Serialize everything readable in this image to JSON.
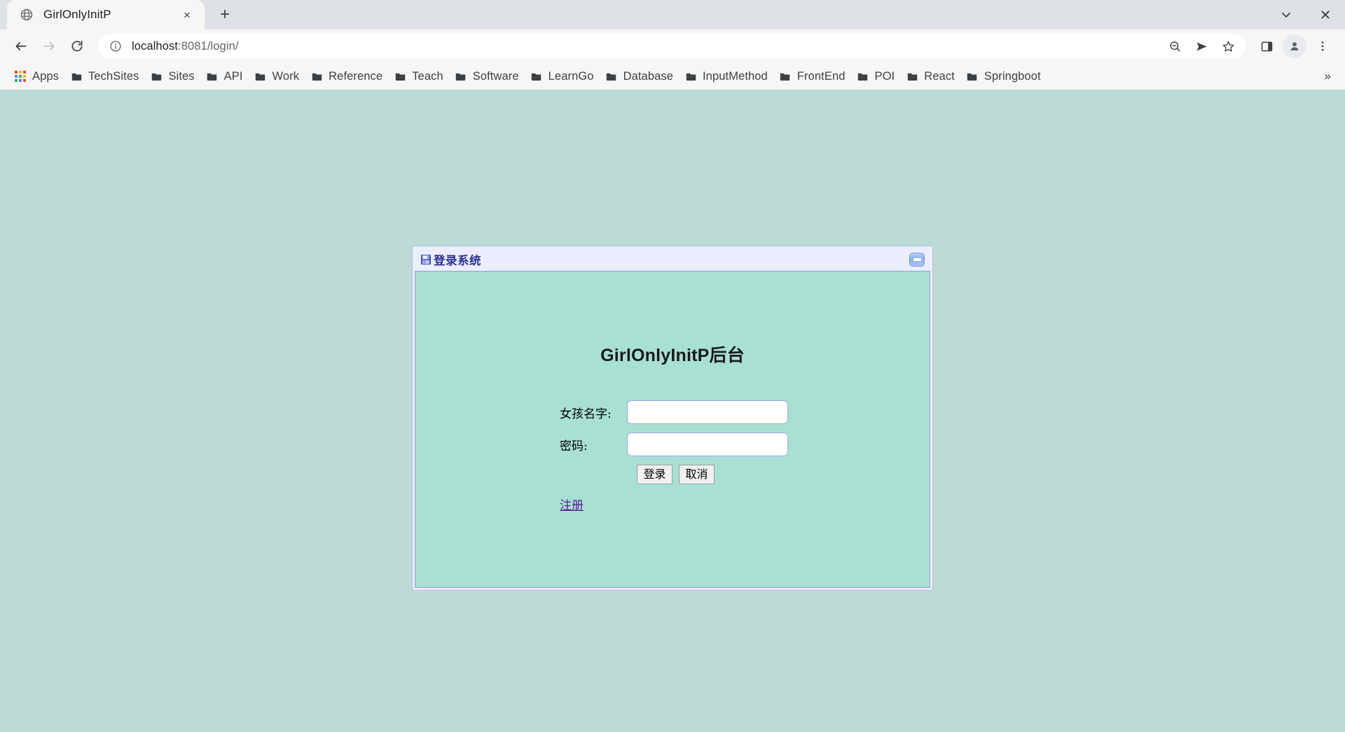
{
  "browser": {
    "tab": {
      "favicon": "globe-icon",
      "title": "GirlOnlyInitP",
      "close_label": "×",
      "newtab_label": "+"
    },
    "window_controls": [
      {
        "name": "minimize-window-button",
        "glyph": "⌄"
      },
      {
        "name": "close-window-button",
        "glyph": "✕"
      }
    ],
    "nav": {
      "back_label": "←",
      "forward_label": "→",
      "reload_label": "↻"
    },
    "omnibox": {
      "info_icon": "info-circle-icon",
      "url_host": "localhost",
      "url_rest": ":8081/login/",
      "full_url": "localhost:8081/login/"
    },
    "toolbar_icons": [
      {
        "name": "zoom-out-icon",
        "title": "Zoom"
      },
      {
        "name": "send-icon",
        "title": "Send"
      },
      {
        "name": "bookmark-star-icon",
        "title": "Bookmark"
      },
      {
        "name": "side-panel-icon",
        "title": "Side panel"
      },
      {
        "name": "profile-avatar-icon",
        "title": "Profile"
      },
      {
        "name": "more-menu-icon",
        "title": "More"
      }
    ],
    "bookmarks": {
      "apps_label": "Apps",
      "items": [
        {
          "label": "TechSites"
        },
        {
          "label": "Sites"
        },
        {
          "label": "API"
        },
        {
          "label": "Work"
        },
        {
          "label": "Reference"
        },
        {
          "label": "Teach"
        },
        {
          "label": "Software"
        },
        {
          "label": "LearnGo"
        },
        {
          "label": "Database"
        },
        {
          "label": "InputMethod"
        },
        {
          "label": "FrontEnd"
        },
        {
          "label": "POI"
        },
        {
          "label": "React"
        },
        {
          "label": "Springboot"
        }
      ],
      "overflow_label": "»"
    }
  },
  "dialog": {
    "title": "登录系统",
    "icon": "save-floppy-icon",
    "minimize_title": "Minimize",
    "heading": "GirlOnlyInitP后台",
    "fields": [
      {
        "label": "女孩名字:",
        "value": "",
        "placeholder": "",
        "type": "text",
        "name": "girl-name-input"
      },
      {
        "label": "密码:",
        "value": "",
        "placeholder": "",
        "type": "password",
        "name": "password-input"
      }
    ],
    "buttons": {
      "submit_label": "登录",
      "cancel_label": "取消"
    },
    "register_link": "注册"
  },
  "colors": {
    "page_background": "#bcdbd6",
    "dialog_body": "#a8e0d4",
    "dialog_titlebar": "#eaeeff",
    "dialog_border": "#9a9ad4",
    "title_text": "#2f2f8f",
    "link": "#551a8b",
    "input_border": "#9aa6e8"
  }
}
